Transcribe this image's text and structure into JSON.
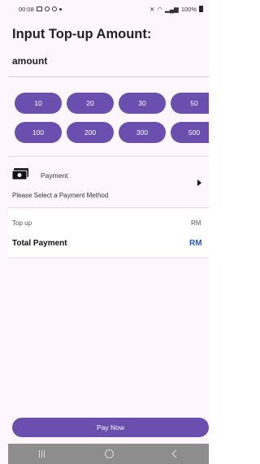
{
  "status_bar": {
    "time": "00:08",
    "battery": "100%"
  },
  "page": {
    "title": "Input Top-up Amount:",
    "amount_label": "amount"
  },
  "amount_options": [
    "10",
    "20",
    "30",
    "50",
    "100",
    "200",
    "300",
    "500"
  ],
  "payment": {
    "label": "Payment",
    "prompt": "Please Select a Payment Method",
    "icon": "cash-icon"
  },
  "summary": {
    "topup_label": "Top up",
    "topup_value": "RM",
    "total_label": "Total Payment",
    "total_value": "RM"
  },
  "actions": {
    "pay_now": "Pay Now"
  },
  "colors": {
    "accent": "#6a4fae",
    "total_value": "#1a5bd6",
    "background": "#fdf6fd"
  }
}
